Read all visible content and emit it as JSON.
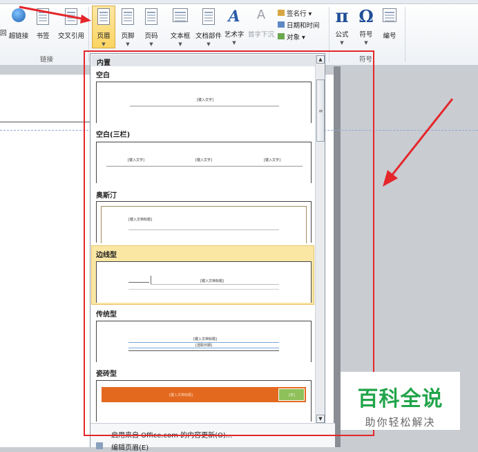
{
  "ribbon": {
    "group_links_label": "链接",
    "group_symbols_label": "符号",
    "buttons": {
      "hyperlink": "超链接",
      "bookmark": "书签",
      "crossref": "交叉引用",
      "header": "页眉",
      "footer": "页脚",
      "page_number": "页码",
      "textbox": "文本框",
      "quickparts": "文档部件",
      "wordart": "艺术字",
      "dropcap": "首字下沉",
      "signature": "签名行",
      "datetime": "日期和时间",
      "object": "对象",
      "equation": "公式",
      "symbol": "符号",
      "number": "编号"
    },
    "left_cut_glyph": "回"
  },
  "gallery": {
    "section_header": "内置",
    "items": [
      {
        "label": "空白",
        "placeholder": "[键入文字]"
      },
      {
        "label": "空白(三栏)",
        "placeholder": "[键入文字]"
      },
      {
        "label": "奥斯汀",
        "placeholder": "[键入文档标题]"
      },
      {
        "label": "边线型",
        "placeholder": "[键入文档标题]"
      },
      {
        "label": "传统型",
        "placeholder": "[键入文档标题]",
        "placeholder2": "[选取日期]"
      },
      {
        "label": "瓷砖型",
        "placeholder": "[键入文档标题]",
        "placeholder2": "[年]"
      }
    ],
    "footer_items": [
      "启用来自 Office.com 的内容更新(O)...",
      "编辑页眉(E)"
    ]
  },
  "watermark": {
    "title": "百科全说",
    "subtitle": "助你轻松解决"
  },
  "colors": {
    "accent_red": "#e4262b",
    "selected_item": "#fbe7a4",
    "tile_orange": "#e3691f",
    "tile_green": "#8fc05a",
    "watermark_green": "#22a44a"
  }
}
